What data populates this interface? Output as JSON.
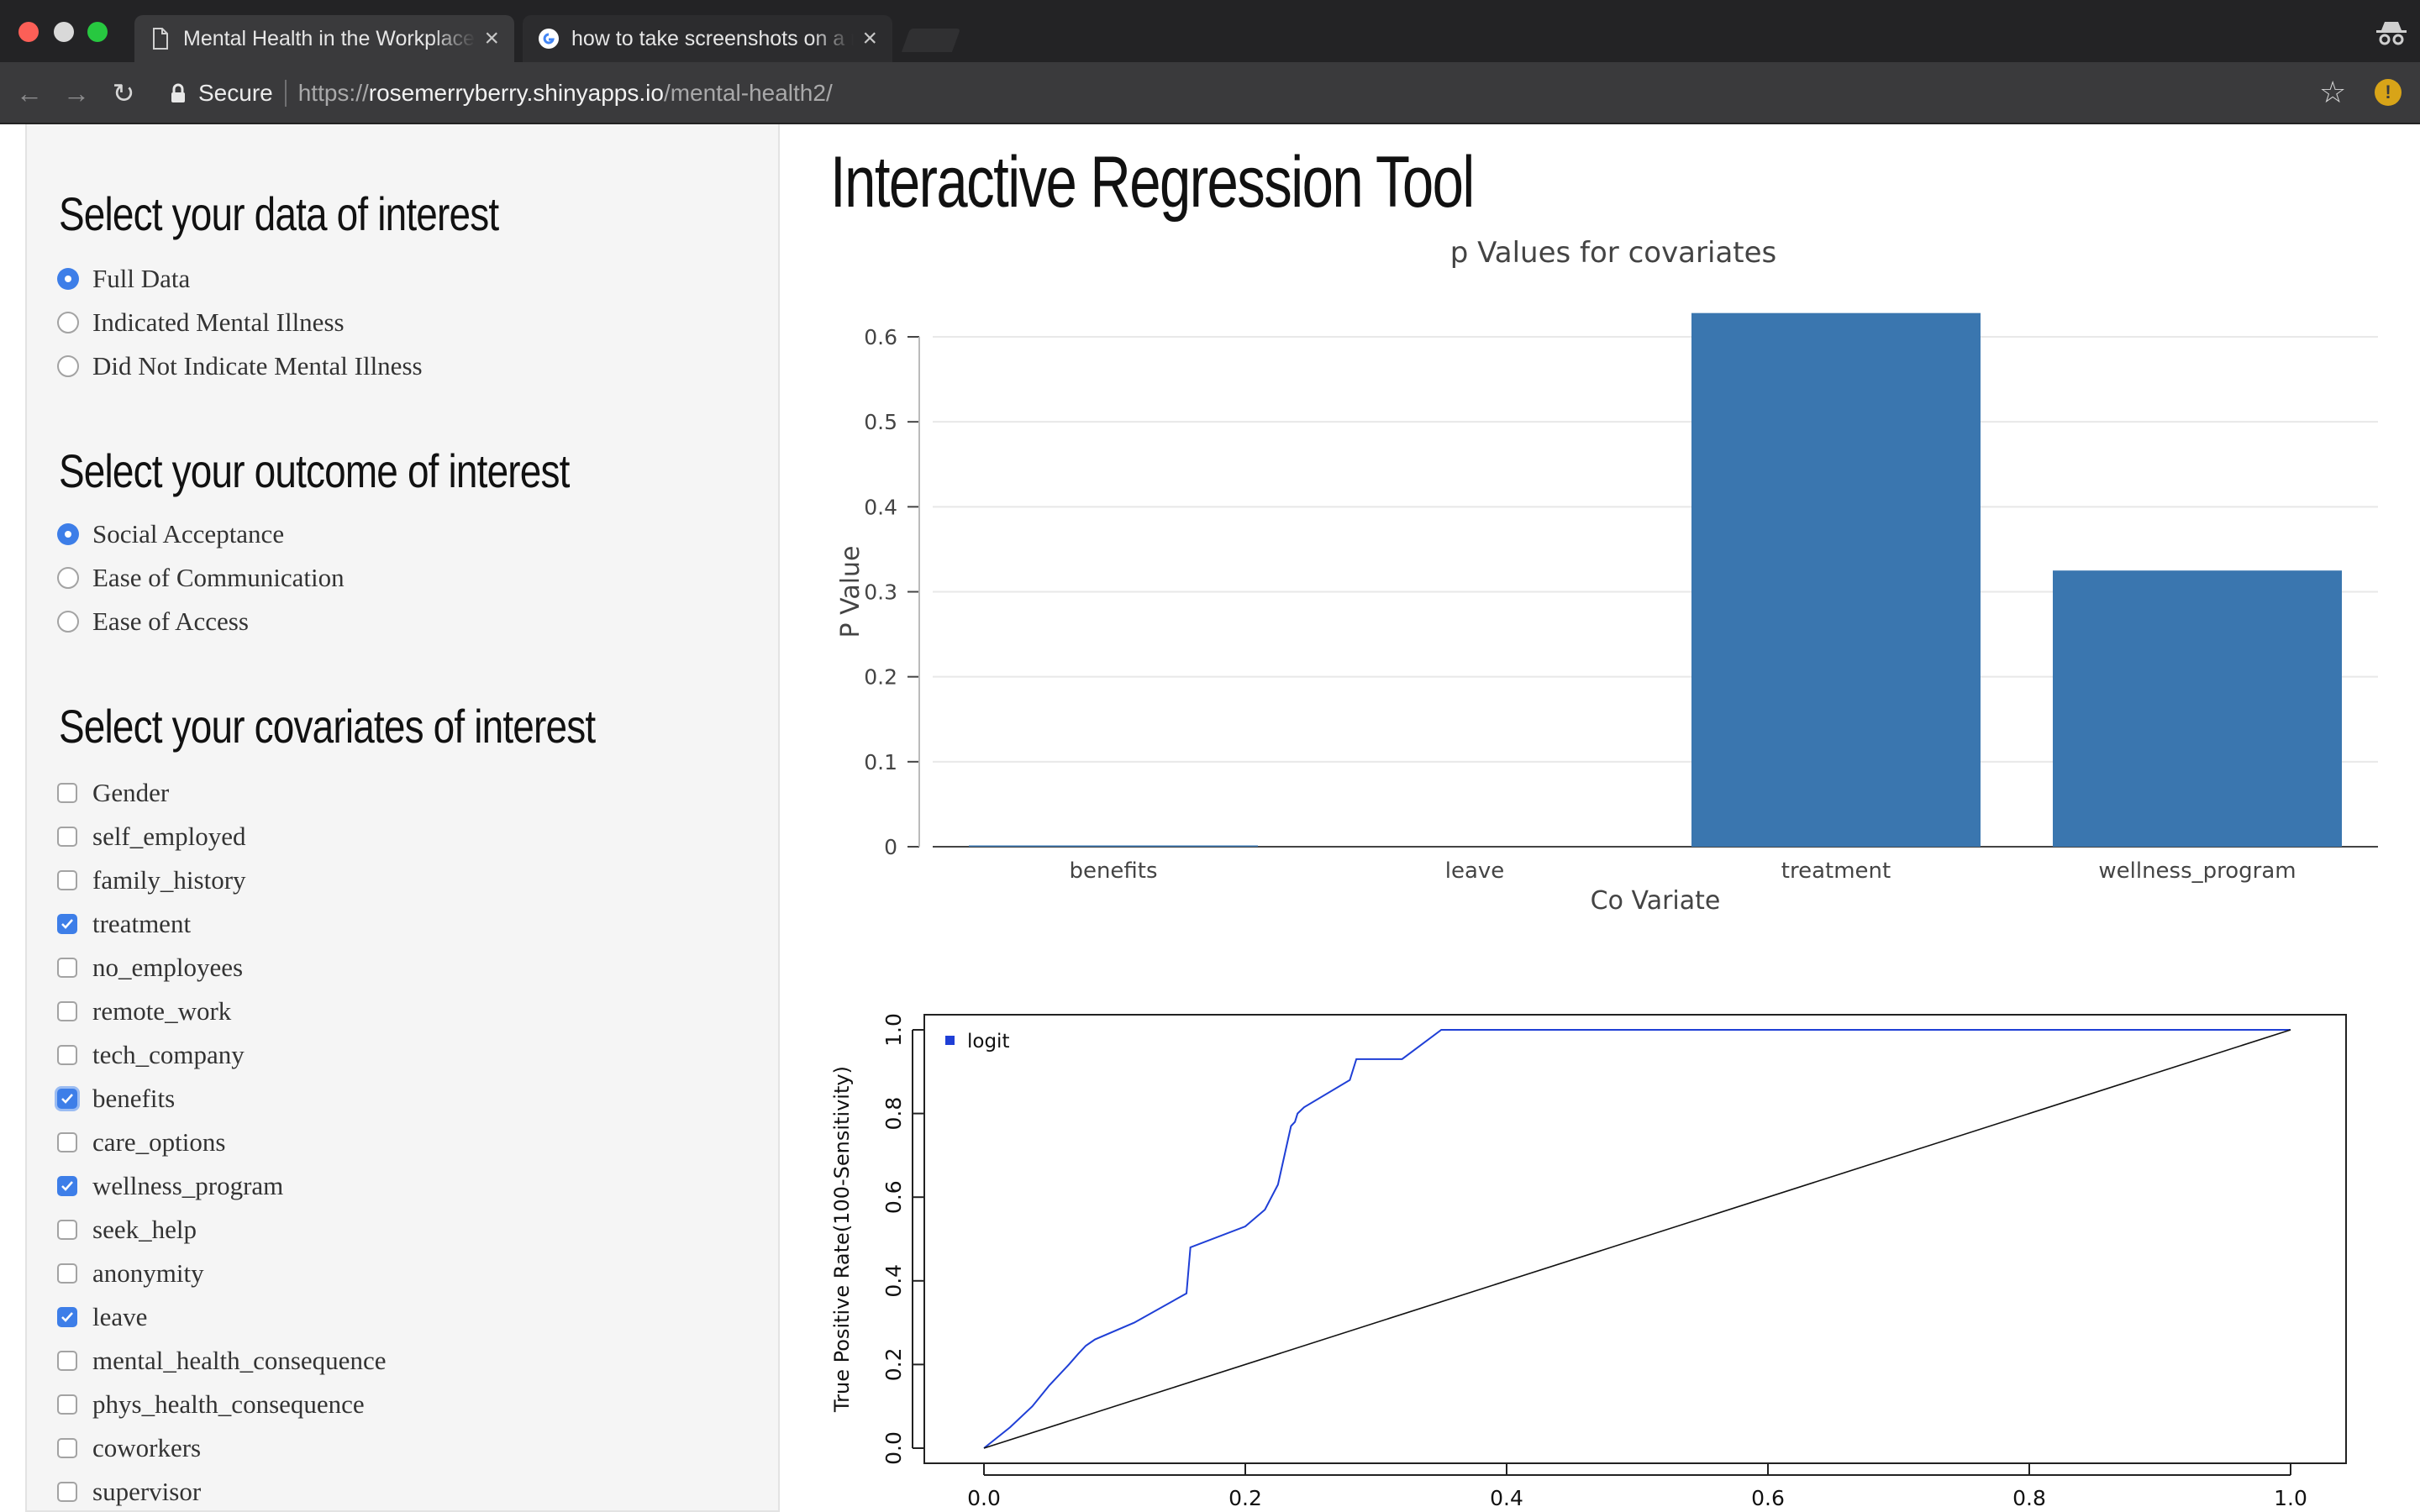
{
  "browser": {
    "tabs": [
      {
        "title": "Mental Health in the Workplace",
        "icon": "document-icon",
        "active": true
      },
      {
        "title": "how to take screenshots on a mac",
        "icon": "google-icon",
        "active": false
      }
    ],
    "secure_label": "Secure",
    "url_scheme": "https://",
    "url_host": "rosemerryberry.shinyapps.io",
    "url_path": "/mental-health2/",
    "extension_badge": "!"
  },
  "sidebar": {
    "data_title": "Select your data of interest",
    "data_options": [
      {
        "label": "Full Data",
        "checked": true
      },
      {
        "label": "Indicated Mental Illness",
        "checked": false
      },
      {
        "label": "Did Not Indicate Mental Illness",
        "checked": false
      }
    ],
    "outcome_title": "Select your outcome of interest",
    "outcome_options": [
      {
        "label": "Social Acceptance",
        "checked": true
      },
      {
        "label": "Ease of Communication",
        "checked": false
      },
      {
        "label": "Ease of Access",
        "checked": false
      }
    ],
    "covariates_title": "Select your covariates of interest",
    "covariates": [
      {
        "label": "Gender",
        "checked": false
      },
      {
        "label": "self_employed",
        "checked": false
      },
      {
        "label": "family_history",
        "checked": false
      },
      {
        "label": "treatment",
        "checked": true
      },
      {
        "label": "no_employees",
        "checked": false
      },
      {
        "label": "remote_work",
        "checked": false
      },
      {
        "label": "tech_company",
        "checked": false
      },
      {
        "label": "benefits",
        "checked": true,
        "focused": true
      },
      {
        "label": "care_options",
        "checked": false
      },
      {
        "label": "wellness_program",
        "checked": true
      },
      {
        "label": "seek_help",
        "checked": false
      },
      {
        "label": "anonymity",
        "checked": false
      },
      {
        "label": "leave",
        "checked": true
      },
      {
        "label": "mental_health_consequence",
        "checked": false
      },
      {
        "label": "phys_health_consequence",
        "checked": false
      },
      {
        "label": "coworkers",
        "checked": false
      },
      {
        "label": "supervisor",
        "checked": false
      }
    ]
  },
  "main": {
    "title": "Interactive Regression Tool"
  },
  "chart_data": [
    {
      "type": "bar",
      "title": "p Values for covariates",
      "xlabel": "Co Variate",
      "ylabel": "P Value",
      "categories": [
        "benefits",
        "leave",
        "treatment",
        "wellness_program"
      ],
      "values": [
        0.0015,
        0.0,
        0.628,
        0.325
      ],
      "ylim": [
        0,
        0.6
      ],
      "yticks": [
        0,
        0.1,
        0.2,
        0.3,
        0.4,
        0.5,
        0.6
      ],
      "ytick_labels": [
        "0",
        "0.1",
        "0.2",
        "0.3",
        "0.4",
        "0.5",
        "0.6"
      ],
      "grid": true,
      "color": "#3a76af"
    },
    {
      "type": "line",
      "xlabel": "",
      "ylabel": "True Positive Rate(100-Sensitivity)",
      "xlim": [
        0,
        1
      ],
      "ylim": [
        0,
        1
      ],
      "xticks": [
        "0.0",
        "0.2",
        "0.4",
        "0.6",
        "0.8",
        "1.0"
      ],
      "yticks": [
        "0.0",
        "0.2",
        "0.4",
        "0.6",
        "0.8",
        "1.0"
      ],
      "legend": "top-left",
      "series": [
        {
          "name": "logit",
          "color": "#1f3fd6",
          "x": [
            0.0,
            0.004,
            0.02,
            0.037,
            0.05,
            0.065,
            0.072,
            0.078,
            0.085,
            0.115,
            0.155,
            0.158,
            0.2,
            0.215,
            0.225,
            0.23,
            0.235,
            0.238,
            0.24,
            0.245,
            0.28,
            0.285,
            0.32,
            0.35,
            1.0
          ],
          "y": [
            0.0,
            0.01,
            0.05,
            0.1,
            0.15,
            0.2,
            0.225,
            0.245,
            0.26,
            0.3,
            0.37,
            0.48,
            0.53,
            0.57,
            0.63,
            0.7,
            0.77,
            0.78,
            0.8,
            0.815,
            0.88,
            0.93,
            0.93,
            1.0,
            1.0
          ]
        },
        {
          "name": "",
          "color": "#111111",
          "x": [
            0.0,
            1.0
          ],
          "y": [
            0.0,
            1.0
          ]
        }
      ]
    }
  ]
}
